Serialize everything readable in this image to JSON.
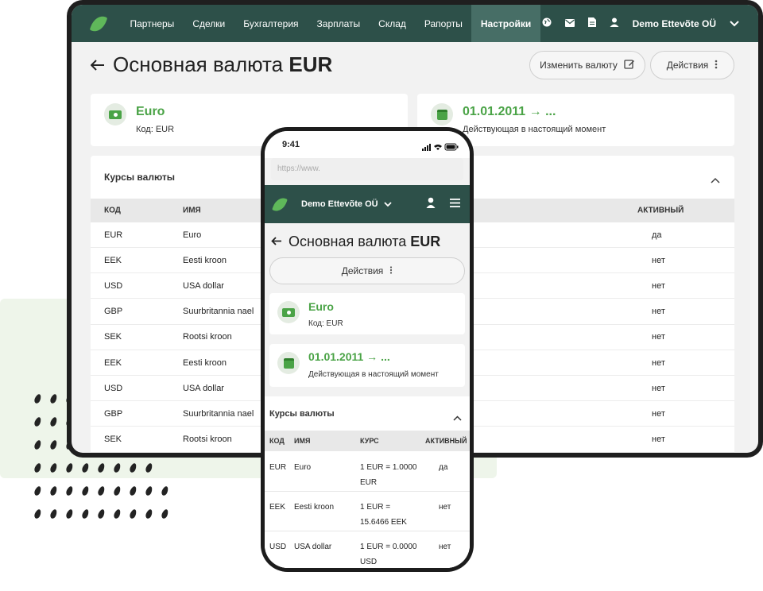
{
  "desktop": {
    "nav": {
      "items": [
        "Партнеры",
        "Сделки",
        "Бухгалтерия",
        "Зарплаты",
        "Склад",
        "Рапорты",
        "Настройки"
      ],
      "active": "Настройки",
      "company": "Demo Ettevõte OÜ"
    },
    "title_prefix": "Основная валюта",
    "title_code": "EUR",
    "change_currency_label": "Изменить валюту",
    "actions_label": "Действия",
    "currency_card": {
      "name": "Euro",
      "code_line": "Код: EUR"
    },
    "date_card": {
      "range": "01.01.2011 → ...",
      "status": "Действующая в настоящий момент"
    },
    "rates_section": {
      "title": "Курсы валюты",
      "headers": {
        "code": "КОД",
        "name": "ИМЯ",
        "active": "АКТИВНЫЙ"
      },
      "rows": [
        {
          "code": "EUR",
          "name": "Euro",
          "active": "да"
        },
        {
          "code": "EEK",
          "name": "Eesti kroon",
          "active": "нет"
        },
        {
          "code": "USD",
          "name": "USA dollar",
          "active": "нет"
        },
        {
          "code": "GBP",
          "name": "Suurbritannia nael",
          "active": "нет"
        },
        {
          "code": "SEK",
          "name": "Rootsi kroon",
          "active": "нет"
        },
        {
          "code": "EEK",
          "name": "Eesti kroon",
          "active": "нет"
        },
        {
          "code": "USD",
          "name": "USA dollar",
          "active": "нет"
        },
        {
          "code": "GBP",
          "name": "Suurbritannia nael",
          "active": "нет"
        },
        {
          "code": "SEK",
          "name": "Rootsi kroon",
          "active": "нет"
        }
      ]
    }
  },
  "mobile": {
    "time": "9:41",
    "url_placeholder": "https://www.",
    "company": "Demo Ettevõte OÜ",
    "title_prefix": "Основная валюта",
    "title_code": "EUR",
    "actions_label": "Действия",
    "currency_card": {
      "name": "Euro",
      "code_line": "Код: EUR"
    },
    "date_card": {
      "range": "01.01.2011 → ...",
      "status": "Действующая в настоящий момент"
    },
    "rates_section": {
      "title": "Курсы валюты",
      "headers": {
        "code": "КОД",
        "name": "ИМЯ",
        "rate": "КУРС",
        "active": "АКТИВНЫЙ"
      },
      "rows": [
        {
          "code": "EUR",
          "name": "Euro",
          "rate_line1": "1 EUR = 1.0000",
          "rate_line2": "EUR",
          "active": "да"
        },
        {
          "code": "EEK",
          "name": "Eesti kroon",
          "rate_line1": "1 EUR =",
          "rate_line2": "15.6466 EEK",
          "active": "нет"
        },
        {
          "code": "USD",
          "name": "USA dollar",
          "rate_line1": "1 EUR = 0.0000",
          "rate_line2": "USD",
          "active": "нет"
        }
      ]
    }
  }
}
